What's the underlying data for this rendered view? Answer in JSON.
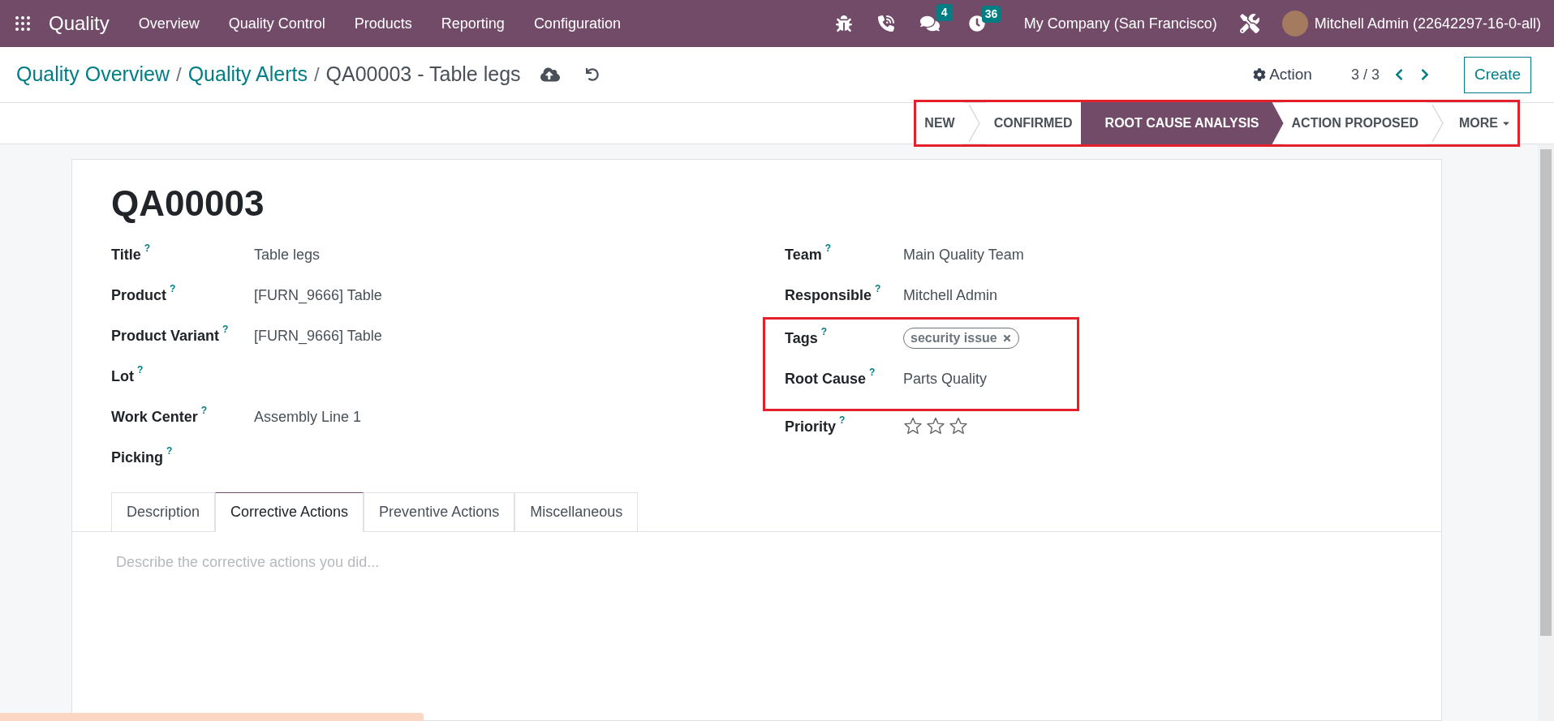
{
  "navbar": {
    "app_name": "Quality",
    "menu": [
      "Overview",
      "Quality Control",
      "Products",
      "Reporting",
      "Configuration"
    ],
    "messages_count": "4",
    "activities_count": "36",
    "company": "My Company (San Francisco)",
    "user": "Mitchell Admin (22642297-16-0-all)"
  },
  "breadcrumb": [
    {
      "label": "Quality Overview",
      "kind": "link"
    },
    {
      "label": "Quality Alerts",
      "kind": "link"
    },
    {
      "label": "QA00003 - Table legs",
      "kind": "current"
    }
  ],
  "breadcrumb_separators": [
    "/",
    "/"
  ],
  "action_label": "Action",
  "pager": "3 / 3",
  "create_label": "Create",
  "stages": [
    {
      "label": "NEW",
      "selected": false
    },
    {
      "label": "CONFIRMED",
      "selected": false
    },
    {
      "label": "ROOT CAUSE ANALYSIS",
      "selected": true
    },
    {
      "label": "ACTION PROPOSED",
      "selected": false
    }
  ],
  "more_label": "MORE",
  "stages_highlighted": true,
  "record": {
    "name": "QA00003",
    "left_fields": [
      {
        "label": "Title",
        "value": "Table legs"
      },
      {
        "label": "Product",
        "value": "[FURN_9666] Table"
      },
      {
        "label": "Product Variant",
        "value": "[FURN_9666] Table"
      },
      {
        "label": "Lot"
      },
      {
        "label": "Work Center",
        "value": "Assembly Line 1"
      },
      {
        "label": "Picking"
      }
    ],
    "right_fields": [
      {
        "label": "Team",
        "kind": "text",
        "value": "Main Quality Team",
        "highlighted": false
      },
      {
        "label": "Responsible",
        "kind": "text",
        "value": "Mitchell Admin",
        "highlighted": false
      },
      {
        "label": "Tags",
        "kind": "tags",
        "tags": [
          "security issue"
        ],
        "highlighted": true
      },
      {
        "label": "Root Cause",
        "kind": "text",
        "value": "Parts Quality",
        "highlighted": true
      },
      {
        "label": "Priority",
        "kind": "stars",
        "stars": 0,
        "highlighted": false
      }
    ],
    "help_mark": "?"
  },
  "tabs": [
    {
      "label": "Description",
      "selected": false
    },
    {
      "label": "Corrective Actions",
      "selected": true
    },
    {
      "label": "Preventive Actions",
      "selected": false
    },
    {
      "label": "Miscellaneous",
      "selected": false
    }
  ],
  "tab_content": {
    "placeholder": "Describe the corrective actions you did..."
  }
}
